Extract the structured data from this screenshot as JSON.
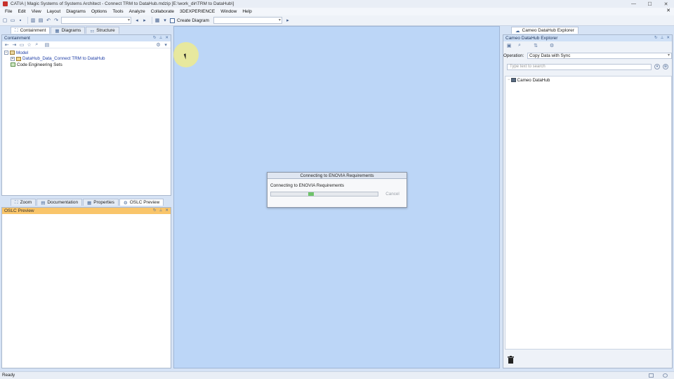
{
  "window": {
    "title": "CATIA | Magic Systems of Systems Architect  - Connect TRM to DataHub.mdzip [E:\\work_dir\\TRM to DataHub\\]",
    "controls": [
      "—",
      "☐",
      "✕"
    ]
  },
  "menu": {
    "items": [
      "File",
      "Edit",
      "View",
      "Layout",
      "Diagrams",
      "Options",
      "Tools",
      "Analyze",
      "Collaborate",
      "3DEXPERIENCE",
      "Window",
      "Help"
    ],
    "close": "✕"
  },
  "toolbar": {
    "create_diagram_label": "Create Diagram"
  },
  "left_tabs": [
    {
      "label": "Containment",
      "icon": "containment-icon",
      "glyph": "⛶"
    },
    {
      "label": "Diagrams",
      "icon": "diagrams-icon",
      "glyph": "▦"
    },
    {
      "label": "Structure",
      "icon": "structure-icon",
      "glyph": "⚏"
    }
  ],
  "containment_panel": {
    "title": "Containment",
    "tree": [
      {
        "label": "Model",
        "expander": "−",
        "level": 0
      },
      {
        "label": "DataHub_Data_Connect TRM to DataHub",
        "expander": "+",
        "level": 1
      },
      {
        "label": "Code Engineering Sets",
        "expander": "",
        "level": 1
      }
    ]
  },
  "bottom_tabs": [
    {
      "label": "Zoom",
      "glyph": "⛶"
    },
    {
      "label": "Documentation",
      "glyph": "▤"
    },
    {
      "label": "Properties",
      "glyph": "▦"
    },
    {
      "label": "OSLC Preview",
      "glyph": "⚙"
    }
  ],
  "oslc_panel": {
    "title": "OSLC Preview"
  },
  "dialog": {
    "title": "Connecting to ENOVIA Requirements",
    "message": "Connecting to ENOVIA Requirements",
    "cancel_label": "Cancel",
    "progress_start": 0.35,
    "progress_width": 0.05
  },
  "right_panel": {
    "tab_label": "Cameo DataHub Explorer",
    "title": "Cameo DataHub Explorer",
    "operation_label": "Operation:",
    "operation_value": "Copy Data with Sync",
    "search_placeholder": "Type text to search",
    "tree": [
      {
        "label": "Cameo DataHub",
        "expander": "−"
      }
    ]
  },
  "status": {
    "text": "Ready"
  },
  "colors": {
    "diagram_bg": "#bcd6f7",
    "panel_header": "#cfe0f6",
    "oslc_header": "#f9c56a",
    "progress": "#6fc36a"
  }
}
